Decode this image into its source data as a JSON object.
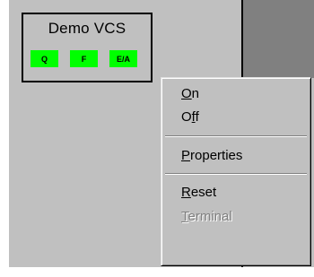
{
  "vcs": {
    "title": "Demo VCS",
    "indicators": [
      {
        "label": "Q",
        "color": "#00ff00"
      },
      {
        "label": "F",
        "color": "#00ff00"
      },
      {
        "label": "E/A",
        "color": "#00ff00"
      }
    ]
  },
  "context_menu": {
    "items": [
      {
        "pre": "",
        "mnemonic": "O",
        "post": "n",
        "enabled": true
      },
      {
        "pre": "O",
        "mnemonic": "f",
        "post": "f",
        "enabled": true
      },
      {
        "pre": "",
        "mnemonic": "P",
        "post": "roperties",
        "enabled": true
      },
      {
        "pre": "",
        "mnemonic": "R",
        "post": "eset",
        "enabled": true
      },
      {
        "pre": "",
        "mnemonic": "T",
        "post": "erminal",
        "enabled": false
      }
    ]
  },
  "colors": {
    "panel": "#c0c0c0",
    "dark_area": "#808080",
    "indicator_on": "#00ff00"
  }
}
